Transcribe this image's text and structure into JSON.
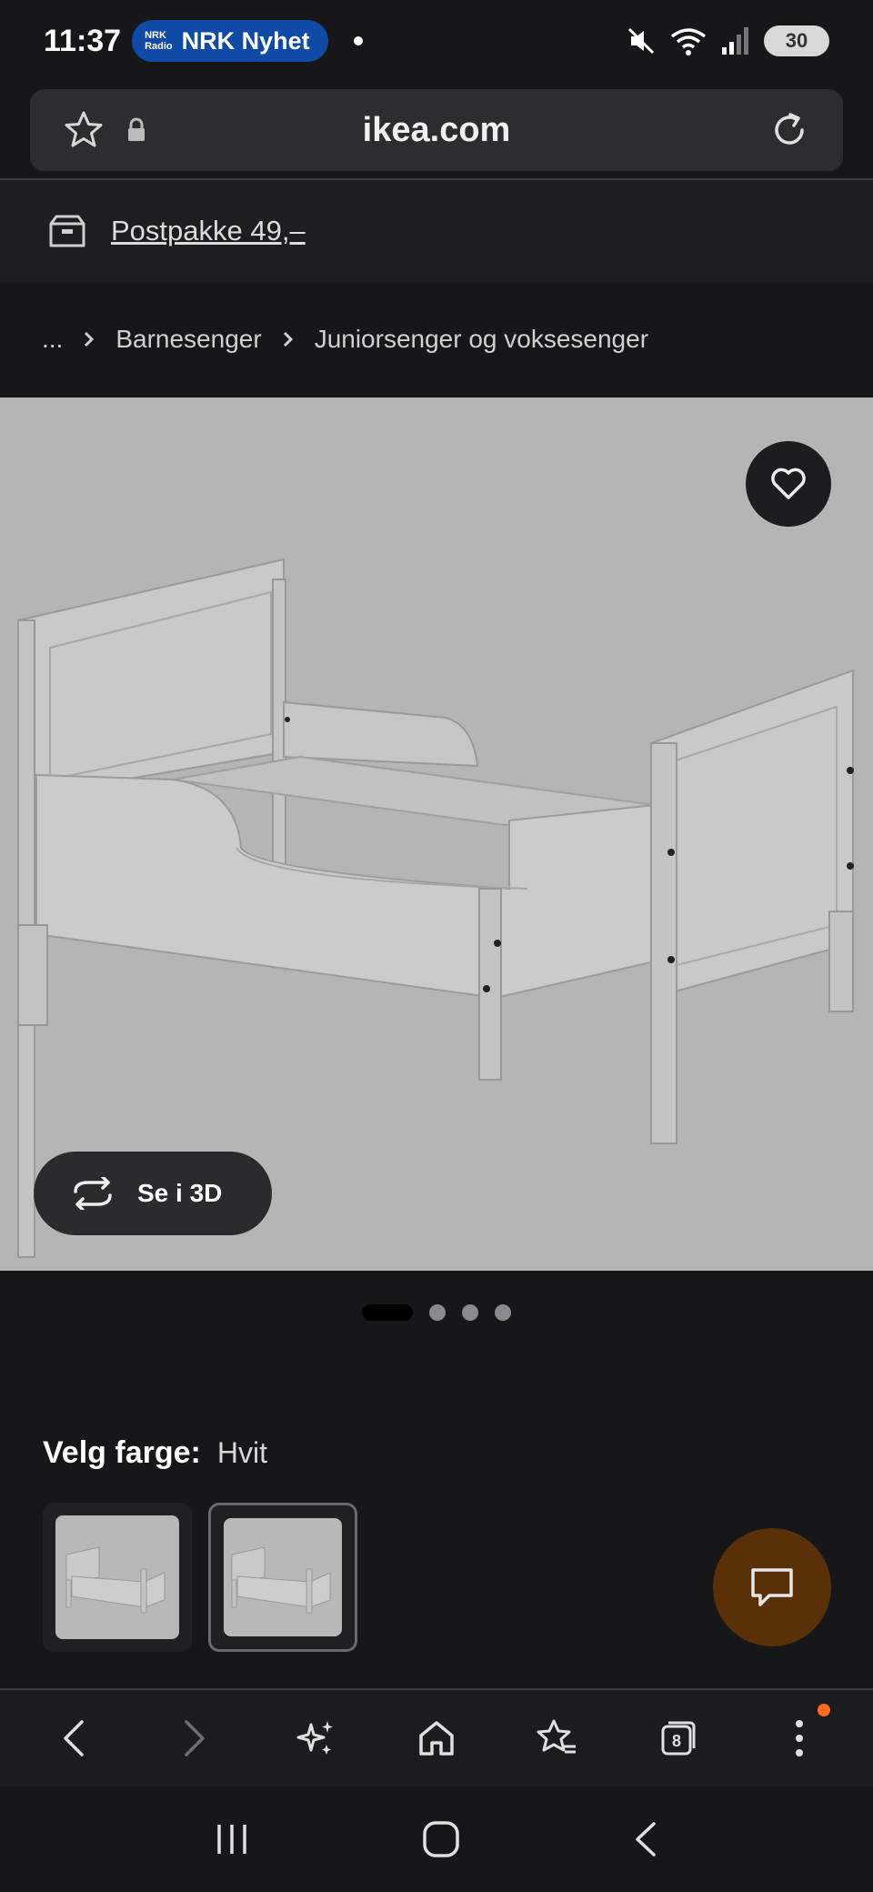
{
  "status_bar": {
    "time": "11:37",
    "notification_app_logo_top": "NRK",
    "notification_app_logo_bottom": "Radio",
    "notification_text": "NRK Nyhet",
    "battery": "30",
    "icons": [
      "mute-icon",
      "wifi-icon",
      "signal-icon",
      "battery-icon"
    ]
  },
  "address_bar": {
    "url": "ikea.com",
    "icons": [
      "bookmark-star-icon",
      "lock-icon",
      "reload-icon"
    ]
  },
  "promo": {
    "icon": "delivery-box-icon",
    "text": "Postpakke 49,–"
  },
  "breadcrumb": {
    "items": [
      "...",
      "Barnesenger",
      "Juniorsenger og voksesenger"
    ]
  },
  "product": {
    "view_3d_label": "Se i 3D",
    "image_count": 4,
    "active_image_index": 0
  },
  "color_select": {
    "label": "Velg farge:",
    "value": "Hvit",
    "swatch_count": 2,
    "selected_swatch_index": 1
  },
  "colors": {
    "background": "#17171a",
    "image_background": "#b5b5b5",
    "chat_fab": "#5a3009",
    "nrk_blue": "#0f4aa6",
    "notification_dot": "#ff6b1a"
  },
  "browser_nav": {
    "tab_count": "8",
    "icons": [
      "back-icon",
      "forward-icon",
      "ai-sparkle-icon",
      "home-icon",
      "bookmarks-icon",
      "tabs-icon",
      "menu-icon"
    ]
  }
}
